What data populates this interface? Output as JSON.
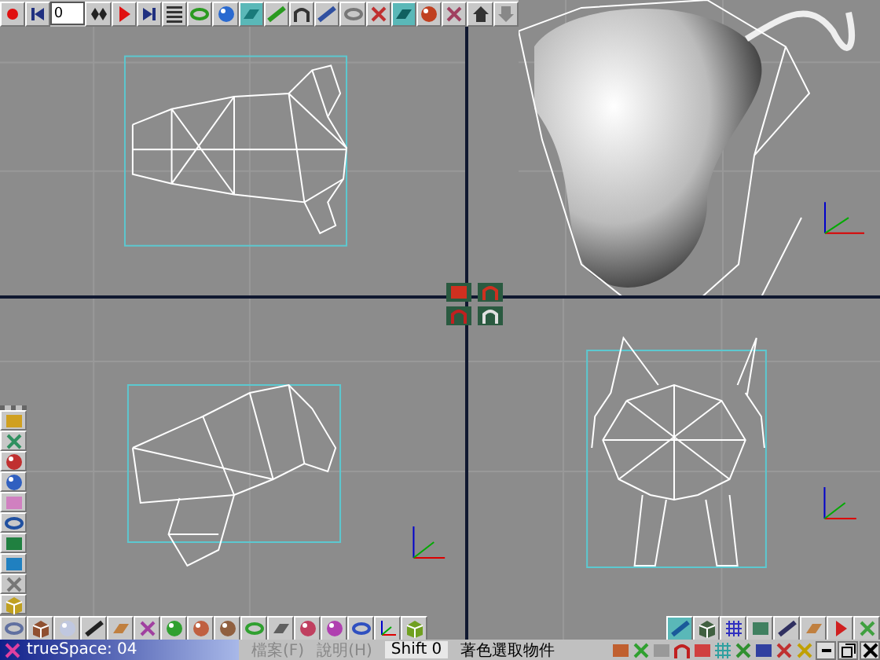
{
  "top_toolbar": {
    "frame_field": "0",
    "buttons": [
      {
        "selected": false
      },
      {
        "selected": false
      },
      {
        "selected": false
      },
      {
        "selected": false
      },
      {
        "selected": false
      },
      {
        "selected": false
      },
      {
        "selected": false
      },
      {
        "selected": false
      },
      {
        "selected": true
      },
      {
        "selected": false
      },
      {
        "selected": false
      },
      {
        "selected": false
      },
      {
        "selected": false
      },
      {
        "selected": false
      },
      {
        "selected": true
      },
      {
        "selected": false
      },
      {
        "selected": false
      },
      {
        "selected": false
      },
      {
        "selected": false
      }
    ]
  },
  "viewports": [
    {
      "kind": "top"
    },
    {
      "kind": "perspective"
    },
    {
      "kind": "side"
    },
    {
      "kind": "front"
    }
  ],
  "left_toolbar": {
    "buttons": [
      {
        "selected": false
      },
      {
        "selected": false
      },
      {
        "selected": false
      },
      {
        "selected": false
      },
      {
        "selected": false
      },
      {
        "selected": false
      },
      {
        "selected": false
      },
      {
        "selected": false
      },
      {
        "selected": false
      },
      {
        "selected": false
      }
    ]
  },
  "bottom_toolbar": {
    "buttons": [
      {
        "selected": false
      },
      {
        "selected": false
      },
      {
        "selected": false
      },
      {
        "selected": false
      },
      {
        "selected": false
      },
      {
        "selected": false
      },
      {
        "selected": false
      },
      {
        "selected": false
      },
      {
        "selected": false
      },
      {
        "selected": false
      },
      {
        "selected": false
      },
      {
        "selected": false
      },
      {
        "selected": false
      },
      {
        "selected": false
      },
      {
        "selected": false
      },
      {
        "selected": false
      }
    ],
    "right_buttons": [
      {
        "selected": true
      },
      {
        "selected": false
      },
      {
        "selected": false
      },
      {
        "selected": false
      },
      {
        "selected": false
      },
      {
        "selected": false
      },
      {
        "selected": false
      },
      {
        "selected": false
      }
    ]
  },
  "status_bar": {
    "app_label": "trueSpace: 04",
    "menus": [
      {
        "label": "檔案(F)",
        "disabled": true
      },
      {
        "label": "說明(H)",
        "disabled": true
      }
    ],
    "shift": "Shift 0",
    "hint": "著色選取物件"
  }
}
